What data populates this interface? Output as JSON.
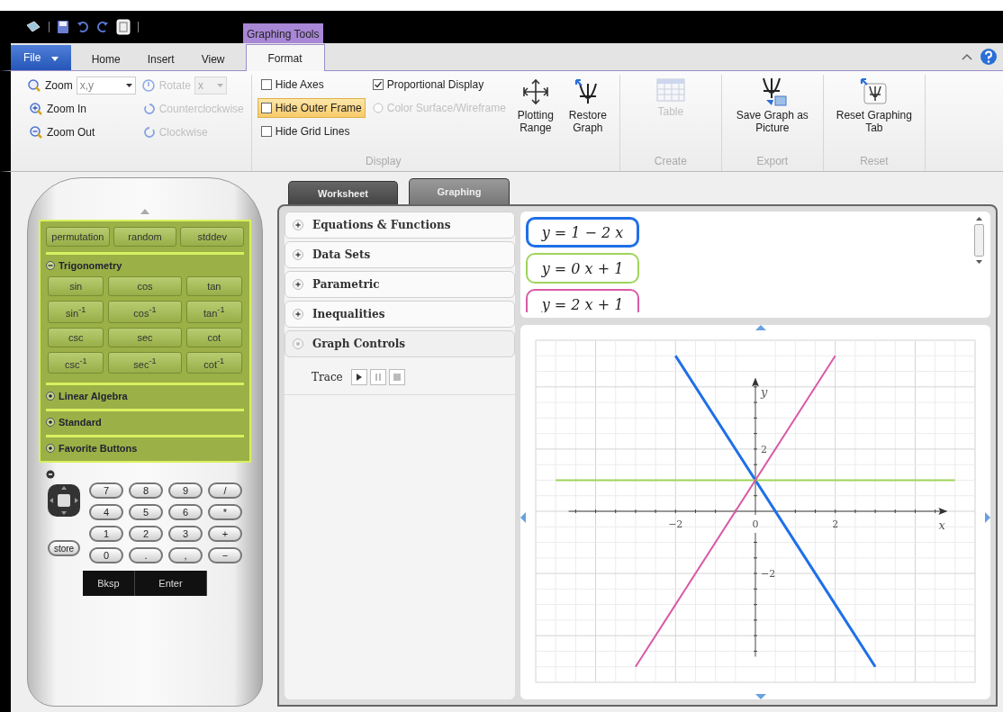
{
  "context_tab": {
    "label": "Graphing Tools"
  },
  "menu_tabs": [
    {
      "label": "File",
      "kind": "file",
      "selected": false
    },
    {
      "label": "Home",
      "kind": "tab",
      "selected": false
    },
    {
      "label": "Insert",
      "kind": "tab",
      "selected": false
    },
    {
      "label": "View",
      "kind": "tab",
      "selected": false
    },
    {
      "label": "Format",
      "kind": "tab",
      "selected": true
    }
  ],
  "view_group": {
    "zoom": {
      "label": "Zoom",
      "value": "x,y"
    },
    "zoom_in": {
      "label": "Zoom In",
      "disabled": false
    },
    "zoom_out": {
      "label": "Zoom Out",
      "disabled": false
    },
    "rotate": {
      "label": "Rotate",
      "value": "x",
      "disabled": true
    },
    "counterclockwise": {
      "label": "Counterclockwise",
      "disabled": true
    },
    "clockwise": {
      "label": "Clockwise",
      "disabled": true
    }
  },
  "display_group": {
    "label": "Display",
    "options": [
      {
        "label": "Hide Axes",
        "kind": "checkbox",
        "checked": false,
        "highlighted": false,
        "disabled": false
      },
      {
        "label": "Hide Outer Frame",
        "kind": "checkbox",
        "checked": false,
        "highlighted": true,
        "disabled": false
      },
      {
        "label": "Hide Grid Lines",
        "kind": "checkbox",
        "checked": false,
        "highlighted": false,
        "disabled": false
      },
      {
        "label": "Proportional Display",
        "kind": "checkbox",
        "checked": true,
        "highlighted": false,
        "disabled": false
      },
      {
        "label": "Color Surface/Wireframe",
        "kind": "radio",
        "checked": false,
        "highlighted": false,
        "disabled": true
      }
    ],
    "buttons": [
      {
        "label": "Plotting Range",
        "kind": "range",
        "disabled": false
      },
      {
        "label": "Restore Graph",
        "kind": "restore",
        "disabled": false
      }
    ]
  },
  "ribbon_groups": [
    {
      "label": "Create",
      "buttons": [
        {
          "label": "Table",
          "kind": "table",
          "disabled": true
        }
      ]
    },
    {
      "label": "Export",
      "buttons": [
        {
          "label": "Save Graph as Picture",
          "kind": "save-picture",
          "disabled": false
        }
      ]
    },
    {
      "label": "Reset",
      "buttons": [
        {
          "label": "Reset Graphing Tab",
          "kind": "reset",
          "disabled": false
        }
      ]
    }
  ],
  "calculator": {
    "top_buttons": [
      "permutation",
      "random",
      "stddev"
    ],
    "sections": [
      {
        "label": "Trigonometry",
        "expanded": true,
        "buttons": [
          "sin",
          "cos",
          "tan",
          "sin$^{-1}$",
          "cos$^{-1}$",
          "tan$^{-1}$",
          "csc",
          "sec",
          "cot",
          "csc$^{-1}$",
          "sec$^{-1}$",
          "cot$^{-1}$"
        ]
      },
      {
        "label": "Linear Algebra",
        "expanded": false
      },
      {
        "label": "Standard",
        "expanded": false
      },
      {
        "label": "Favorite Buttons",
        "expanded": false
      }
    ],
    "keys": [
      [
        "7",
        "8",
        "9",
        "/"
      ],
      [
        "4",
        "5",
        "6",
        "*"
      ],
      [
        "1",
        "2",
        "3",
        "+"
      ],
      [
        "0",
        ".",
        ",",
        "−"
      ]
    ],
    "store": "store",
    "bottom_keys": [
      "Bksp",
      "Enter"
    ]
  },
  "worksheet_tabs": [
    {
      "label": "Worksheet",
      "selected": false
    },
    {
      "label": "Graphing",
      "selected": true
    }
  ],
  "accordion": [
    {
      "label": "Equations & Functions",
      "expanded": false
    },
    {
      "label": "Data Sets",
      "expanded": false
    },
    {
      "label": "Parametric",
      "expanded": false
    },
    {
      "label": "Inequalities",
      "expanded": false
    },
    {
      "label": "Graph Controls",
      "expanded": true
    }
  ],
  "trace": {
    "label": "Trace",
    "buttons": [
      {
        "kind": "play"
      },
      {
        "kind": "pause"
      },
      {
        "kind": "stop"
      }
    ]
  },
  "equations": [
    {
      "text": "y = 1 − 2 x",
      "color": "#1f6fe8",
      "selected": true
    },
    {
      "text": "y = 0 x + 1",
      "color": "#9fd45a",
      "selected": false
    },
    {
      "text": "y = 2 x + 1",
      "color": "#d85aa6",
      "selected": false
    }
  ],
  "graph": {
    "chart_data": {
      "type": "line",
      "xlabel": "x",
      "ylabel": "y",
      "x": [
        -5,
        -3,
        -2,
        2,
        3,
        5
      ],
      "series": [
        {
          "color": "#1f6fe8",
          "values": [
            null,
            null,
            5,
            -3,
            -5,
            null
          ]
        },
        {
          "color": "#9fd45a",
          "values": [
            1,
            1,
            1,
            1,
            1,
            1
          ]
        },
        {
          "color": "#d85aa6",
          "values": [
            null,
            -5,
            -3,
            5,
            null,
            null
          ]
        }
      ],
      "grid": true,
      "xlim": [
        -5.5,
        5.5
      ],
      "ylim": [
        -5.5,
        5.5
      ],
      "xticks": [
        {
          "value": -2,
          "label": "−2"
        },
        {
          "value": 0,
          "label": "0"
        },
        {
          "value": 2,
          "label": "2"
        }
      ],
      "yticks": [
        {
          "value": -2,
          "label": "−2"
        },
        {
          "value": 2,
          "label": "2"
        }
      ]
    }
  }
}
